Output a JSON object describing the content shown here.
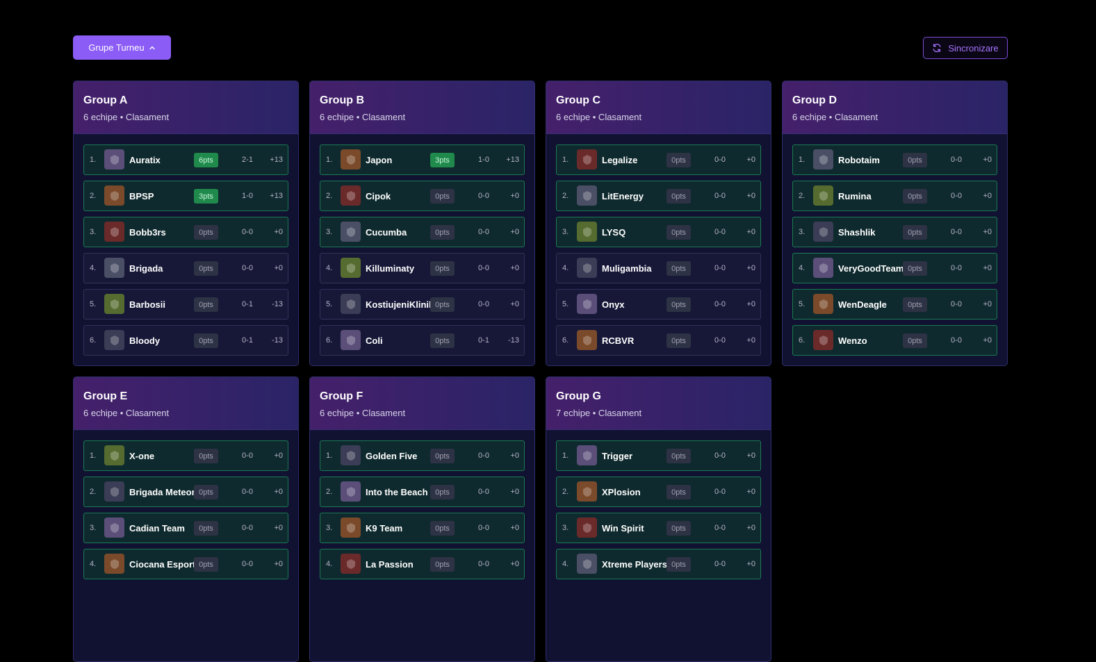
{
  "toolbar": {
    "groups_button": "Grupe Turneu",
    "sync_button": "Sincronizare"
  },
  "colors": {
    "accent": "#8b5cf6",
    "points_badge_win": "#1f8a4c",
    "row_border_green": "#1a7a52"
  },
  "groups": [
    {
      "title": "Group A",
      "subtitle": "6 echipe • Clasament",
      "teams": [
        {
          "rank": "1.",
          "name": "Auratix",
          "pts": "6pts",
          "record": "2-1",
          "diff": "+13",
          "pts_win": true
        },
        {
          "rank": "2.",
          "name": "BPSP",
          "pts": "3pts",
          "record": "1-0",
          "diff": "+13",
          "pts_win": true
        },
        {
          "rank": "3.",
          "name": "Bobb3rs",
          "pts": "0pts",
          "record": "0-0",
          "diff": "+0"
        },
        {
          "rank": "4.",
          "name": "Brigada",
          "pts": "0pts",
          "record": "0-0",
          "diff": "+0"
        },
        {
          "rank": "5.",
          "name": "Barbosii",
          "pts": "0pts",
          "record": "0-1",
          "diff": "-13"
        },
        {
          "rank": "6.",
          "name": "Bloody",
          "pts": "0pts",
          "record": "0-1",
          "diff": "-13"
        }
      ]
    },
    {
      "title": "Group B",
      "subtitle": "6 echipe • Clasament",
      "teams": [
        {
          "rank": "1.",
          "name": "Japon",
          "pts": "3pts",
          "record": "1-0",
          "diff": "+13",
          "pts_win": true
        },
        {
          "rank": "2.",
          "name": "Cipok",
          "pts": "0pts",
          "record": "0-0",
          "diff": "+0"
        },
        {
          "rank": "3.",
          "name": "Cucumba",
          "pts": "0pts",
          "record": "0-0",
          "diff": "+0"
        },
        {
          "rank": "4.",
          "name": "Killuminaty",
          "pts": "0pts",
          "record": "0-0",
          "diff": "+0"
        },
        {
          "rank": "5.",
          "name": "KostiujeniKlinik",
          "pts": "0pts",
          "record": "0-0",
          "diff": "+0"
        },
        {
          "rank": "6.",
          "name": "Coli",
          "pts": "0pts",
          "record": "0-1",
          "diff": "-13"
        }
      ]
    },
    {
      "title": "Group C",
      "subtitle": "6 echipe • Clasament",
      "teams": [
        {
          "rank": "1.",
          "name": "Legalize",
          "pts": "0pts",
          "record": "0-0",
          "diff": "+0"
        },
        {
          "rank": "2.",
          "name": "LitEnergy",
          "pts": "0pts",
          "record": "0-0",
          "diff": "+0"
        },
        {
          "rank": "3.",
          "name": "LYSQ",
          "pts": "0pts",
          "record": "0-0",
          "diff": "+0"
        },
        {
          "rank": "4.",
          "name": "Muligambia",
          "pts": "0pts",
          "record": "0-0",
          "diff": "+0"
        },
        {
          "rank": "5.",
          "name": "Onyx",
          "pts": "0pts",
          "record": "0-0",
          "diff": "+0"
        },
        {
          "rank": "6.",
          "name": "RCBVR",
          "pts": "0pts",
          "record": "0-0",
          "diff": "+0"
        }
      ]
    },
    {
      "title": "Group D",
      "subtitle": "6 echipe • Clasament",
      "teams": [
        {
          "rank": "1.",
          "name": "Robotaim",
          "pts": "0pts",
          "record": "0-0",
          "diff": "+0"
        },
        {
          "rank": "2.",
          "name": "Rumina",
          "pts": "0pts",
          "record": "0-0",
          "diff": "+0"
        },
        {
          "rank": "3.",
          "name": "Shashlik",
          "pts": "0pts",
          "record": "0-0",
          "diff": "+0"
        },
        {
          "rank": "4.",
          "name": "VeryGoodTeam",
          "pts": "0pts",
          "record": "0-0",
          "diff": "+0"
        },
        {
          "rank": "5.",
          "name": "WenDeagle",
          "pts": "0pts",
          "record": "0-0",
          "diff": "+0"
        },
        {
          "rank": "6.",
          "name": "Wenzo",
          "pts": "0pts",
          "record": "0-0",
          "diff": "+0"
        }
      ]
    },
    {
      "title": "Group E",
      "subtitle": "6 echipe • Clasament",
      "teams": [
        {
          "rank": "1.",
          "name": "X-one",
          "pts": "0pts",
          "record": "0-0",
          "diff": "+0"
        },
        {
          "rank": "2.",
          "name": "Brigada Meteor",
          "pts": "0pts",
          "record": "0-0",
          "diff": "+0"
        },
        {
          "rank": "3.",
          "name": "Cadian Team",
          "pts": "0pts",
          "record": "0-0",
          "diff": "+0"
        },
        {
          "rank": "4.",
          "name": "Ciocana Esports",
          "pts": "0pts",
          "record": "0-0",
          "diff": "+0"
        }
      ]
    },
    {
      "title": "Group F",
      "subtitle": "6 echipe • Clasament",
      "teams": [
        {
          "rank": "1.",
          "name": "Golden Five",
          "pts": "0pts",
          "record": "0-0",
          "diff": "+0"
        },
        {
          "rank": "2.",
          "name": "Into the Beach",
          "pts": "0pts",
          "record": "0-0",
          "diff": "+0"
        },
        {
          "rank": "3.",
          "name": "K9 Team",
          "pts": "0pts",
          "record": "0-0",
          "diff": "+0"
        },
        {
          "rank": "4.",
          "name": "La Passion",
          "pts": "0pts",
          "record": "0-0",
          "diff": "+0"
        }
      ]
    },
    {
      "title": "Group G",
      "subtitle": "7 echipe • Clasament",
      "teams": [
        {
          "rank": "1.",
          "name": "Trigger",
          "pts": "0pts",
          "record": "0-0",
          "diff": "+0"
        },
        {
          "rank": "2.",
          "name": "XPlosion",
          "pts": "0pts",
          "record": "0-0",
          "diff": "+0"
        },
        {
          "rank": "3.",
          "name": "Win Spirit",
          "pts": "0pts",
          "record": "0-0",
          "diff": "+0"
        },
        {
          "rank": "4.",
          "name": "Xtreme Players",
          "pts": "0pts",
          "record": "0-0",
          "diff": "+0"
        }
      ]
    }
  ]
}
